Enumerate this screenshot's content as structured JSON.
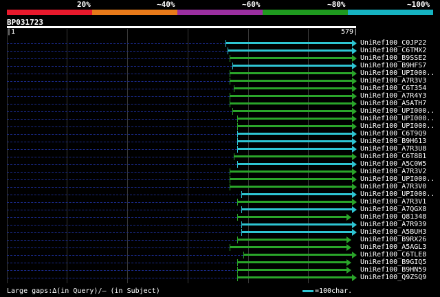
{
  "legend": {
    "labels": [
      "20%",
      "~40%",
      "~60%",
      "~80%",
      "~100%"
    ],
    "colors": [
      "#e8192c",
      "#e87a1a",
      "#9b2fa0",
      "#1f9a1f",
      "#16b3c2"
    ]
  },
  "query": {
    "name": "BP031723",
    "start": "1",
    "end": "579"
  },
  "hits": [
    {
      "label": "UniRef100_C0JP22",
      "start": 363,
      "color": "#2ec5d3"
    },
    {
      "label": "UniRef100_C6TMX2",
      "start": 366,
      "color": "#2ec5d3"
    },
    {
      "label": "UniRef100_B9SSE2",
      "start": 369,
      "color": "#2aa52a"
    },
    {
      "label": "UniRef100_B9HFS7",
      "start": 374,
      "color": "#2ec5d3"
    },
    {
      "label": "UniRef100_UPI000..",
      "start": 369,
      "color": "#2aa52a"
    },
    {
      "label": "UniRef100_A7R3V3",
      "start": 369,
      "color": "#2aa52a"
    },
    {
      "label": "UniRef100_C6T354",
      "start": 376,
      "color": "#2aa52a"
    },
    {
      "label": "UniRef100_A7R4Y3",
      "start": 369,
      "color": "#2aa52a"
    },
    {
      "label": "UniRef100_A5ATH7",
      "start": 369,
      "color": "#2aa52a"
    },
    {
      "label": "UniRef100_UPI000..",
      "start": 374,
      "color": "#2aa52a"
    },
    {
      "label": "UniRef100_UPI000..",
      "start": 382,
      "color": "#2aa52a"
    },
    {
      "label": "UniRef100_UPI000..",
      "start": 382,
      "color": "#2aa52a"
    },
    {
      "label": "UniRef100_C6T9Q9",
      "start": 382,
      "color": "#2ec5d3"
    },
    {
      "label": "UniRef100_B9H613",
      "start": 382,
      "color": "#2ec5d3"
    },
    {
      "label": "UniRef100_A7R3U8",
      "start": 382,
      "color": "#2ec5d3"
    },
    {
      "label": "UniRef100_C6T8B1",
      "start": 376,
      "color": "#2aa52a"
    },
    {
      "label": "UniRef100_A5C0W5",
      "start": 382,
      "color": "#2ec5d3"
    },
    {
      "label": "UniRef100_A7R3V2",
      "start": 369,
      "color": "#2aa52a"
    },
    {
      "label": "UniRef100_UPI000..",
      "start": 369,
      "color": "#2aa52a"
    },
    {
      "label": "UniRef100_A7R3V0",
      "start": 369,
      "color": "#2aa52a"
    },
    {
      "label": "UniRef100_UPI000..",
      "start": 389,
      "color": "#2ec5d3"
    },
    {
      "label": "UniRef100_A7R3V1",
      "start": 382,
      "color": "#2aa52a"
    },
    {
      "label": "UniRef100_A7QGX8",
      "start": 389,
      "color": "#2ec5d3"
    },
    {
      "label": "UniRef100_Q81348",
      "start": 382,
      "color": "#2aa52a"
    },
    {
      "label": "UniRef100_A7R939",
      "start": 389,
      "color": "#2ec5d3"
    },
    {
      "label": "UniRef100_A5BUH3",
      "start": 389,
      "color": "#2ec5d3"
    },
    {
      "label": "UniRef100_B9RX26",
      "start": 382,
      "color": "#2aa52a"
    },
    {
      "label": "UniRef100_A5AGL3",
      "start": 369,
      "color": "#2aa52a"
    },
    {
      "label": "UniRef100_C6TLE8",
      "start": 392,
      "color": "#2aa52a"
    },
    {
      "label": "UniRef100_B9GIQ5",
      "start": 382,
      "color": "#2aa52a"
    },
    {
      "label": "UniRef100_B9HN59",
      "start": 382,
      "color": "#2aa52a"
    },
    {
      "label": "UniRef100_Q9ZSQ9",
      "start": 382,
      "color": "#2aa52a"
    }
  ],
  "hit_ends": [
    579,
    579,
    579,
    579,
    579,
    579,
    579,
    579,
    579,
    579,
    579,
    579,
    579,
    579,
    579,
    579,
    579,
    579,
    579,
    579,
    579,
    579,
    579,
    570,
    579,
    579,
    570,
    570,
    579,
    570,
    570,
    579
  ],
  "footer": {
    "gaps_text": "Large gaps:∆(in Query)/– (in Subject)",
    "scale_text": "=100char."
  }
}
